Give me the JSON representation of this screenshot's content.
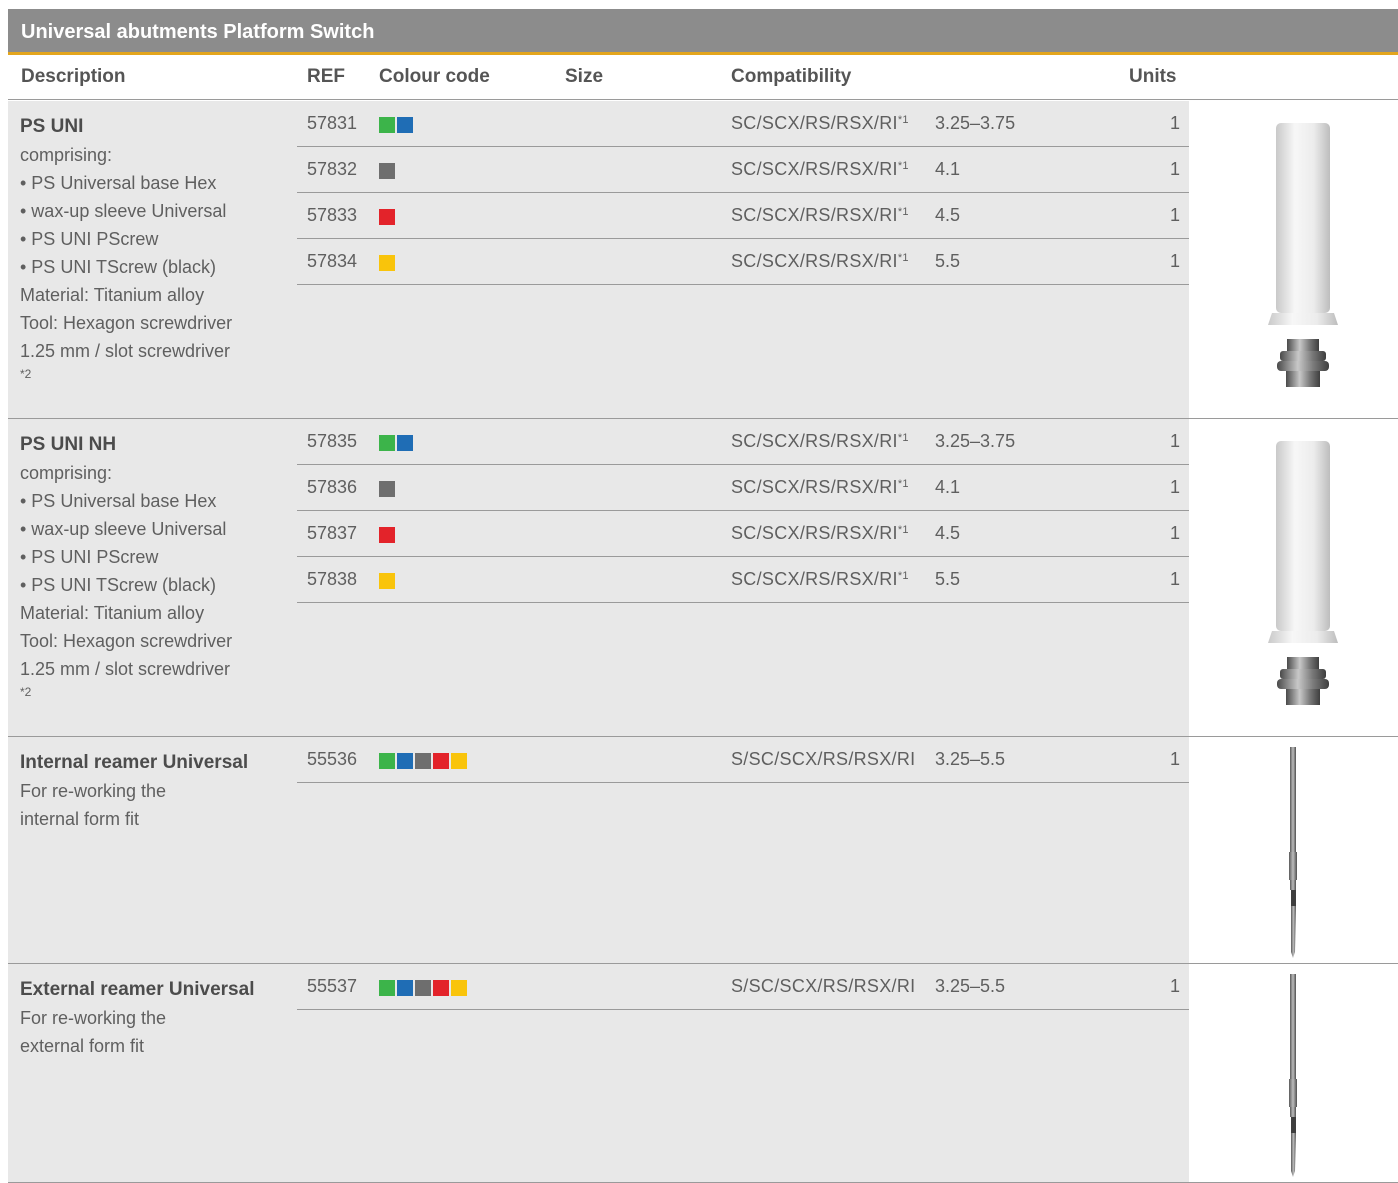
{
  "title": "Universal abutments Platform Switch",
  "headers": {
    "description": "Description",
    "ref": "REF",
    "colour": "Colour code",
    "size": "Size",
    "compat": "Compatibility",
    "units": "Units"
  },
  "colors": {
    "green": "#3cb44a",
    "blue": "#1f6db5",
    "gray": "#6e6e6e",
    "red": "#e3232a",
    "yellow": "#f9c40b",
    "accent": "#e3a51d"
  },
  "sections": [
    {
      "title": "PS UNI",
      "lines": [
        "comprising:",
        "• PS Universal base Hex",
        "• wax-up sleeve Universal",
        "• PS UNI PScrew",
        "• PS UNI TScrew (black)",
        "Material: Titanium alloy",
        "Tool: Hexagon screwdriver",
        "1.25 mm / slot screwdriver"
      ],
      "footnote": "*2",
      "image": "abutment-icon",
      "rows": [
        {
          "ref": "57831",
          "swatches": [
            "green",
            "blue"
          ],
          "compat": "SC/SCX/RS/RSX/RI",
          "sup": "*1",
          "size": "3.25–3.75",
          "units": "1"
        },
        {
          "ref": "57832",
          "swatches": [
            "gray"
          ],
          "compat": "SC/SCX/RS/RSX/RI",
          "sup": "*1",
          "size": "4.1",
          "units": "1"
        },
        {
          "ref": "57833",
          "swatches": [
            "red"
          ],
          "compat": "SC/SCX/RS/RSX/RI",
          "sup": "*1",
          "size": "4.5",
          "units": "1"
        },
        {
          "ref": "57834",
          "swatches": [
            "yellow"
          ],
          "compat": "SC/SCX/RS/RSX/RI",
          "sup": "*1",
          "size": "5.5",
          "units": "1"
        }
      ]
    },
    {
      "title": "PS UNI NH",
      "lines": [
        "comprising:",
        "• PS Universal base Hex",
        "• wax-up sleeve Universal",
        "• PS UNI PScrew",
        "• PS UNI TScrew (black)",
        "Material: Titanium alloy",
        "Tool: Hexagon screwdriver",
        "1.25 mm / slot screwdriver"
      ],
      "footnote": "*2",
      "image": "abutment-icon",
      "rows": [
        {
          "ref": "57835",
          "swatches": [
            "green",
            "blue"
          ],
          "compat": "SC/SCX/RS/RSX/RI",
          "sup": "*1",
          "size": "3.25–3.75",
          "units": "1"
        },
        {
          "ref": "57836",
          "swatches": [
            "gray"
          ],
          "compat": "SC/SCX/RS/RSX/RI",
          "sup": "*1",
          "size": "4.1",
          "units": "1"
        },
        {
          "ref": "57837",
          "swatches": [
            "red"
          ],
          "compat": "SC/SCX/RS/RSX/RI",
          "sup": "*1",
          "size": "4.5",
          "units": "1"
        },
        {
          "ref": "57838",
          "swatches": [
            "yellow"
          ],
          "compat": "SC/SCX/RS/RSX/RI",
          "sup": "*1",
          "size": "5.5",
          "units": "1"
        }
      ]
    },
    {
      "title": "Internal reamer Universal",
      "lines": [
        "For re-working the",
        "internal form fit"
      ],
      "footnote": "",
      "image": "reamer-icon",
      "rows": [
        {
          "ref": "55536",
          "swatches": [
            "green",
            "blue",
            "gray",
            "red",
            "yellow"
          ],
          "compat": "S/SC/SCX/RS/RSX/RI",
          "sup": "",
          "size": "3.25–5.5",
          "units": "1"
        }
      ]
    },
    {
      "title": "External reamer Universal",
      "lines": [
        "For re-working the",
        "external form fit"
      ],
      "footnote": "",
      "image": "reamer-icon",
      "rows": [
        {
          "ref": "55537",
          "swatches": [
            "green",
            "blue",
            "gray",
            "red",
            "yellow"
          ],
          "compat": "S/SC/SCX/RS/RSX/RI",
          "sup": "",
          "size": "3.25–5.5",
          "units": "1"
        }
      ]
    }
  ]
}
